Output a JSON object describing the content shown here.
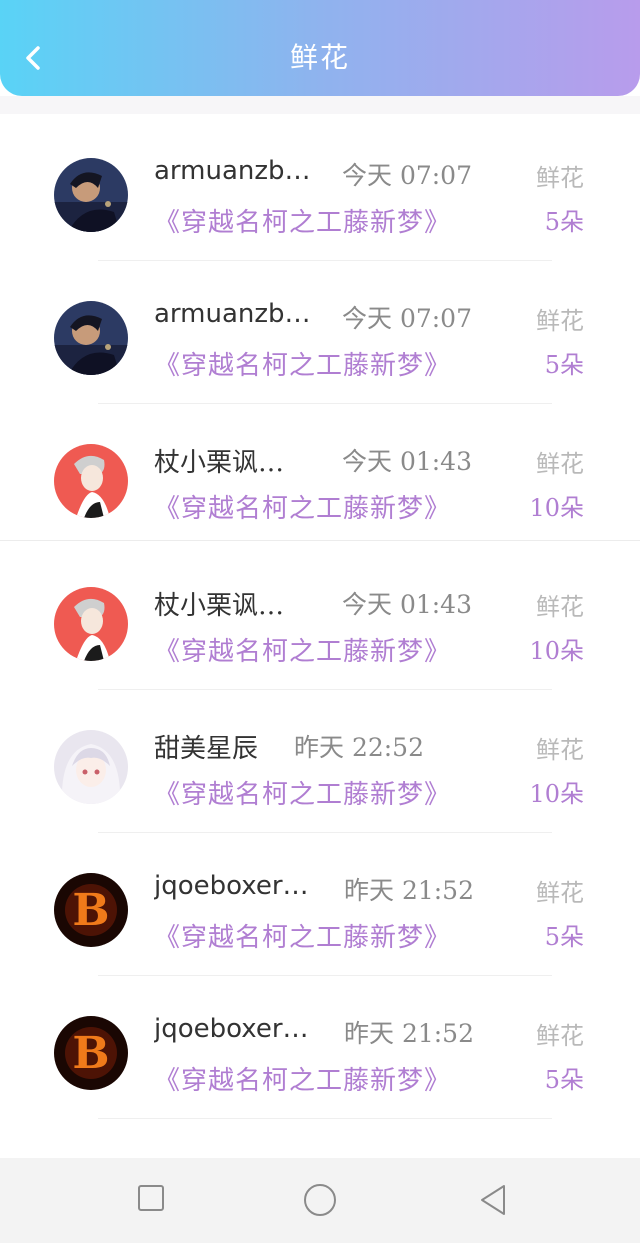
{
  "header": {
    "title": "鲜花",
    "back_icon": "chevron-left-icon",
    "gradient": [
      "#59d3f6",
      "#b89cec"
    ]
  },
  "colors": {
    "accent": "#b07ed2",
    "muted": "#b9b9b9",
    "text": "#333333"
  },
  "entries": [
    {
      "user": "armuanzb…",
      "time": "今天 07:07",
      "book": "《穿越名柯之工藤新梦》",
      "label": "鲜花",
      "count": "5朵"
    },
    {
      "user": "armuanzb…",
      "time": "今天 07:07",
      "book": "《穿越名柯之工藤新梦》",
      "label": "鲜花",
      "count": "5朵"
    },
    {
      "user": "杖小栗讽…",
      "time": "今天 01:43",
      "book": "《穿越名柯之工藤新梦》",
      "label": "鲜花",
      "count": "10朵"
    },
    {
      "user": "杖小栗讽…",
      "time": "今天 01:43",
      "book": "《穿越名柯之工藤新梦》",
      "label": "鲜花",
      "count": "10朵"
    },
    {
      "user": "甜美星辰",
      "time": "昨天 22:52",
      "book": "《穿越名柯之工藤新梦》",
      "label": "鲜花",
      "count": "10朵"
    },
    {
      "user": "jqoeboxer…",
      "time": "昨天 21:52",
      "book": "《穿越名柯之工藤新梦》",
      "label": "鲜花",
      "count": "5朵"
    },
    {
      "user": "jqoeboxer…",
      "time": "昨天 21:52",
      "book": "《穿越名柯之工藤新梦》",
      "label": "鲜花",
      "count": "5朵"
    }
  ],
  "navbar": {
    "icons": [
      "square-recent-apps-icon",
      "circle-home-icon",
      "triangle-back-icon"
    ]
  }
}
